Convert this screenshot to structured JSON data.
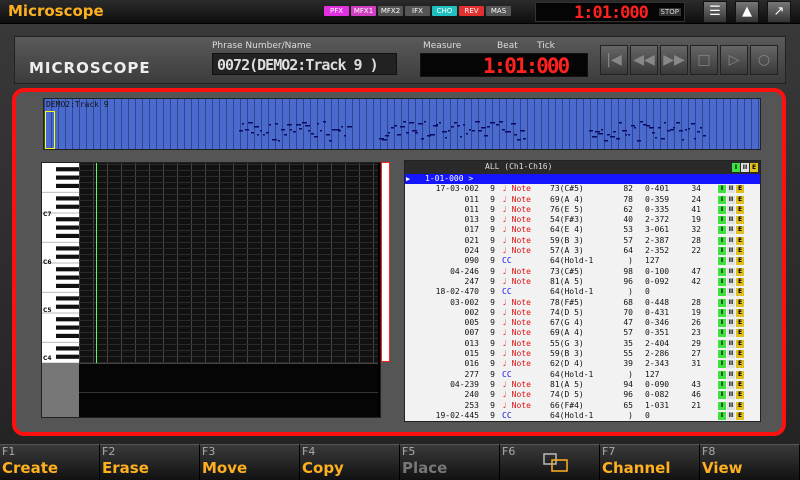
{
  "app_title": "Microscope",
  "top": {
    "fx": [
      {
        "label": "PFX",
        "color": "#e030e0"
      },
      {
        "label": "MFX1",
        "color": "#d040c0"
      },
      {
        "label": "MFX2",
        "color": "#555555"
      },
      {
        "label": "IFX",
        "color": "#555555"
      },
      {
        "label": "CHO",
        "color": "#20c0c0"
      },
      {
        "label": "REV",
        "color": "#e03030"
      },
      {
        "label": "MAS",
        "color": "#555555"
      }
    ],
    "time": "1:01:000",
    "stop": "STOP",
    "icons": [
      "menu-icon",
      "up-arrow-icon",
      "exit-icon"
    ]
  },
  "header": {
    "logo": "MICROSCOPE",
    "phrase_label": "Phrase Number/Name",
    "phrase_value": "0072(DEMO2:Track 9 )",
    "measure_label": "Measure",
    "beat_label": "Beat",
    "tick_label": "Tick",
    "measure_value": "1:01:000",
    "transport": [
      "|◀",
      "◀◀",
      "▶▶",
      "□",
      "▷",
      "○"
    ]
  },
  "overview": {
    "label": "DEMO2:Track 9"
  },
  "roll": {
    "octaves": [
      "C7",
      "C6",
      "C5",
      "C4"
    ]
  },
  "list": {
    "title": "ALL  (Ch1-Ch16)",
    "badges": [
      "I",
      "II",
      "E"
    ],
    "cursor_row": "1-01-000  >",
    "rows": [
      {
        "t": "17-03-002",
        "ch": "9",
        "type": "Note",
        "p1": "73(C#5)",
        "v": "82",
        "g": "0-401",
        "d": "34"
      },
      {
        "t": "011",
        "ch": "9",
        "type": "Note",
        "p1": "69(A 4)",
        "v": "78",
        "g": "0-359",
        "d": "24"
      },
      {
        "t": "011",
        "ch": "9",
        "type": "Note",
        "p1": "76(E 5)",
        "v": "62",
        "g": "0-335",
        "d": "41"
      },
      {
        "t": "013",
        "ch": "9",
        "type": "Note",
        "p1": "54(F#3)",
        "v": "40",
        "g": "2-372",
        "d": "19"
      },
      {
        "t": "017",
        "ch": "9",
        "type": "Note",
        "p1": "64(E 4)",
        "v": "53",
        "g": "3-061",
        "d": "32"
      },
      {
        "t": "021",
        "ch": "9",
        "type": "Note",
        "p1": "59(B 3)",
        "v": "57",
        "g": "2-387",
        "d": "28"
      },
      {
        "t": "024",
        "ch": "9",
        "type": "Note",
        "p1": "57(A 3)",
        "v": "64",
        "g": "2-352",
        "d": "22"
      },
      {
        "t": "090",
        "ch": "9",
        "type": "CC",
        "p1": "64(Hold-1",
        "v": ")",
        "g": "127",
        "d": ""
      },
      {
        "t": "04-246",
        "ch": "9",
        "type": "Note",
        "p1": "73(C#5)",
        "v": "98",
        "g": "0-100",
        "d": "47"
      },
      {
        "t": "247",
        "ch": "9",
        "type": "Note",
        "p1": "81(A 5)",
        "v": "96",
        "g": "0-092",
        "d": "42"
      },
      {
        "t": "18-02-470",
        "ch": "9",
        "type": "CC",
        "p1": "64(Hold-1",
        "v": ")",
        "g": "0",
        "d": ""
      },
      {
        "t": "03-002",
        "ch": "9",
        "type": "Note",
        "p1": "78(F#5)",
        "v": "68",
        "g": "0-448",
        "d": "28"
      },
      {
        "t": "002",
        "ch": "9",
        "type": "Note",
        "p1": "74(D 5)",
        "v": "70",
        "g": "0-431",
        "d": "19"
      },
      {
        "t": "005",
        "ch": "9",
        "type": "Note",
        "p1": "67(G 4)",
        "v": "47",
        "g": "0-346",
        "d": "26"
      },
      {
        "t": "007",
        "ch": "9",
        "type": "Note",
        "p1": "69(A 4)",
        "v": "57",
        "g": "0-351",
        "d": "23"
      },
      {
        "t": "013",
        "ch": "9",
        "type": "Note",
        "p1": "55(G 3)",
        "v": "35",
        "g": "2-404",
        "d": "29"
      },
      {
        "t": "015",
        "ch": "9",
        "type": "Note",
        "p1": "59(B 3)",
        "v": "55",
        "g": "2-286",
        "d": "27"
      },
      {
        "t": "016",
        "ch": "9",
        "type": "Note",
        "p1": "62(D 4)",
        "v": "39",
        "g": "2-343",
        "d": "31"
      },
      {
        "t": "277",
        "ch": "9",
        "type": "CC",
        "p1": "64(Hold-1",
        "v": ")",
        "g": "127",
        "d": ""
      },
      {
        "t": "04-239",
        "ch": "9",
        "type": "Note",
        "p1": "81(A 5)",
        "v": "94",
        "g": "0-090",
        "d": "43"
      },
      {
        "t": "240",
        "ch": "9",
        "type": "Note",
        "p1": "74(D 5)",
        "v": "96",
        "g": "0-082",
        "d": "46"
      },
      {
        "t": "253",
        "ch": "9",
        "type": "Note",
        "p1": "66(F#4)",
        "v": "65",
        "g": "1-031",
        "d": "21"
      },
      {
        "t": "19-02-445",
        "ch": "9",
        "type": "CC",
        "p1": "64(Hold-1",
        "v": ")",
        "g": "0",
        "d": ""
      }
    ]
  },
  "fkeys": [
    {
      "num": "F1",
      "label": "Create",
      "enabled": true
    },
    {
      "num": "F2",
      "label": "Erase",
      "enabled": true
    },
    {
      "num": "F3",
      "label": "Move",
      "enabled": true
    },
    {
      "num": "F4",
      "label": "Copy",
      "enabled": true
    },
    {
      "num": "F5",
      "label": "Place",
      "enabled": false
    },
    {
      "num": "F6",
      "label": "",
      "enabled": true,
      "icon": "zoom-window-icon"
    },
    {
      "num": "F7",
      "label": "Channel",
      "enabled": true
    },
    {
      "num": "F8",
      "label": "View",
      "enabled": true
    }
  ]
}
